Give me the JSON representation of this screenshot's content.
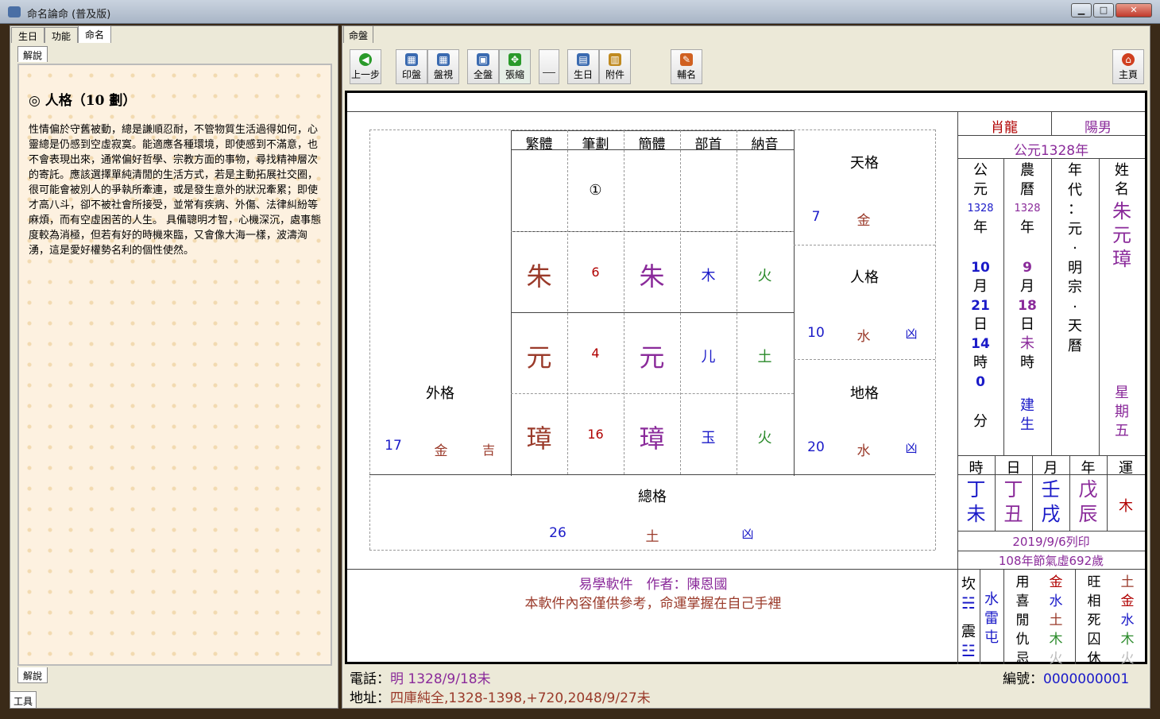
{
  "window": {
    "title": "命名論命 (普及版)",
    "min": "▁",
    "max": "□",
    "close": "✕"
  },
  "left": {
    "tabs": [
      "生日",
      "功能",
      "命名"
    ],
    "sub_tab": "解說",
    "heading": "◎ 人格（10 劃）",
    "text": "性情偏於守舊被動，總是謙順忍耐，不管物質生活過得如何，心靈總是仍感到空虛寂寞。能適應各種環境，即使感到不滿意，也不會表現出來，通常偏好哲學、宗教方面的事物，尋找精神層次的寄託。應該選擇單純清閒的生活方式，若是主動拓展社交圈，很可能會被別人的爭執所牽連，或是發生意外的狀況牽累；即使才高八斗，卻不被社會所接受，並常有疾病、外傷、法律糾紛等麻煩，而有空虛困苦的人生。 具備聰明才智，心機深沉，處事態度較為消極，但若有好的時機來臨，又會像大海一樣，波濤洶湧，這是愛好權勢名利的個性使然。",
    "bottom_tab": "解說",
    "tools": "工具"
  },
  "right_tab": "命盤",
  "toolbar": [
    {
      "label": "上一步",
      "icon": "back-arrow-icon",
      "color": "#2a9a2a",
      "glyph": "◀"
    },
    {
      "label": "印盤",
      "icon": "print-icon",
      "color": "#3a6ab0",
      "glyph": "▦"
    },
    {
      "label": "盤視",
      "icon": "view-icon",
      "color": "#3a6ab0",
      "glyph": "▦"
    },
    {
      "label": "全盤",
      "icon": "fullboard-icon",
      "color": "#3a6ab0",
      "glyph": "▣"
    },
    {
      "label": "張縮",
      "icon": "expand-icon",
      "color": "#2a9a2a",
      "glyph": "✥"
    },
    {
      "label": "",
      "icon": "blank-icon",
      "color": "#ece9d8",
      "glyph": ""
    },
    {
      "label": "生日",
      "icon": "birthday-icon",
      "color": "#3a6ab0",
      "glyph": "▤"
    },
    {
      "label": "附件",
      "icon": "attach-icon",
      "color": "#c08a20",
      "glyph": "▥"
    },
    {
      "label": "輔名",
      "icon": "wand-icon",
      "color": "#d06020",
      "glyph": "✎"
    },
    {
      "label": "主頁",
      "icon": "home-icon",
      "color": "#d04020",
      "glyph": "⌂"
    }
  ],
  "grid": {
    "headers": [
      "繁體",
      "筆劃",
      "簡體",
      "部首",
      "納音"
    ],
    "top_mark": "①",
    "rows": [
      {
        "trad": "朱",
        "strokes": "6",
        "simp": "朱",
        "radical": "木",
        "element": "火"
      },
      {
        "trad": "元",
        "strokes": "4",
        "simp": "元",
        "radical": "儿",
        "element": "土"
      },
      {
        "trad": "璋",
        "strokes": "16",
        "simp": "璋",
        "radical": "玉",
        "element": "火"
      }
    ],
    "tiange": {
      "label": "天格",
      "num": "7",
      "el": "金",
      "luck": ""
    },
    "renge": {
      "label": "人格",
      "num": "10",
      "el": "水",
      "luck": "凶"
    },
    "dige": {
      "label": "地格",
      "num": "20",
      "el": "水",
      "luck": "凶"
    },
    "waige": {
      "label": "外格",
      "num": "17",
      "el": "金",
      "luck": "吉"
    },
    "zongge": {
      "label": "總格",
      "num": "26",
      "el": "土",
      "luck": "凶"
    }
  },
  "info": {
    "zodiac": "肖龍",
    "gender": "陽男",
    "year_line": "公元1328年",
    "col_gongyuan": {
      "h1": "公",
      "h2": "元",
      "year": "1328",
      "y": "年",
      "month": "10",
      "m": "月",
      "day": "21",
      "d": "日",
      "hour": "14",
      "h": "時",
      "min": "0",
      "mi": "分"
    },
    "col_nongli": {
      "h1": "農",
      "h2": "曆",
      "year": "1328",
      "y": "年",
      "month": "9",
      "m": "月",
      "day": "18",
      "d": "日",
      "hour": "未",
      "h": "時",
      "s1": "建",
      "s2": "生"
    },
    "col_era": [
      "年",
      "代",
      "：",
      "元",
      "·",
      "明",
      "宗",
      "·",
      "天",
      "曆"
    ],
    "col_name": {
      "h1": "姓",
      "h2": "名",
      "n1": "朱",
      "n2": "元",
      "n3": "璋",
      "w1": "星",
      "w2": "期",
      "w3": "五"
    },
    "pillar_heads": [
      "時",
      "日",
      "月",
      "年",
      "運"
    ],
    "pillars": [
      {
        "top": "丁",
        "bot": "未"
      },
      {
        "top": "丁",
        "bot": "丑"
      },
      {
        "top": "壬",
        "bot": "戌"
      },
      {
        "top": "戊",
        "bot": "辰"
      }
    ],
    "luck": "木",
    "print_date": "2019/9/6列印",
    "age": "108年節氣虛692歲"
  },
  "footer": {
    "line1": "易學軟件　作者：陳恩國",
    "line2": "本軟件內容僅供參考，命運掌握在自己手裡"
  },
  "gua": {
    "kan": "坎",
    "zhen": "震",
    "tri1": "☵",
    "tri2": "☳",
    "name": [
      "水",
      "雷",
      "屯"
    ],
    "yong": [
      "用",
      "喜",
      "閒",
      "仇",
      "忌"
    ],
    "yong_el": [
      "金",
      "水",
      "土",
      "木",
      "火"
    ],
    "wang": [
      "旺",
      "相",
      "死",
      "囚",
      "休"
    ],
    "wang_el": [
      "土",
      "金",
      "水",
      "木",
      "火"
    ]
  },
  "status": {
    "phone_label": "電話：",
    "phone_value": "明 1328/9/18未",
    "addr_label": "地址：",
    "addr_value": "四庫純全,1328-1398,+720,2048/9/27未",
    "serial_label": "編號：",
    "serial_value": "0000000001"
  }
}
